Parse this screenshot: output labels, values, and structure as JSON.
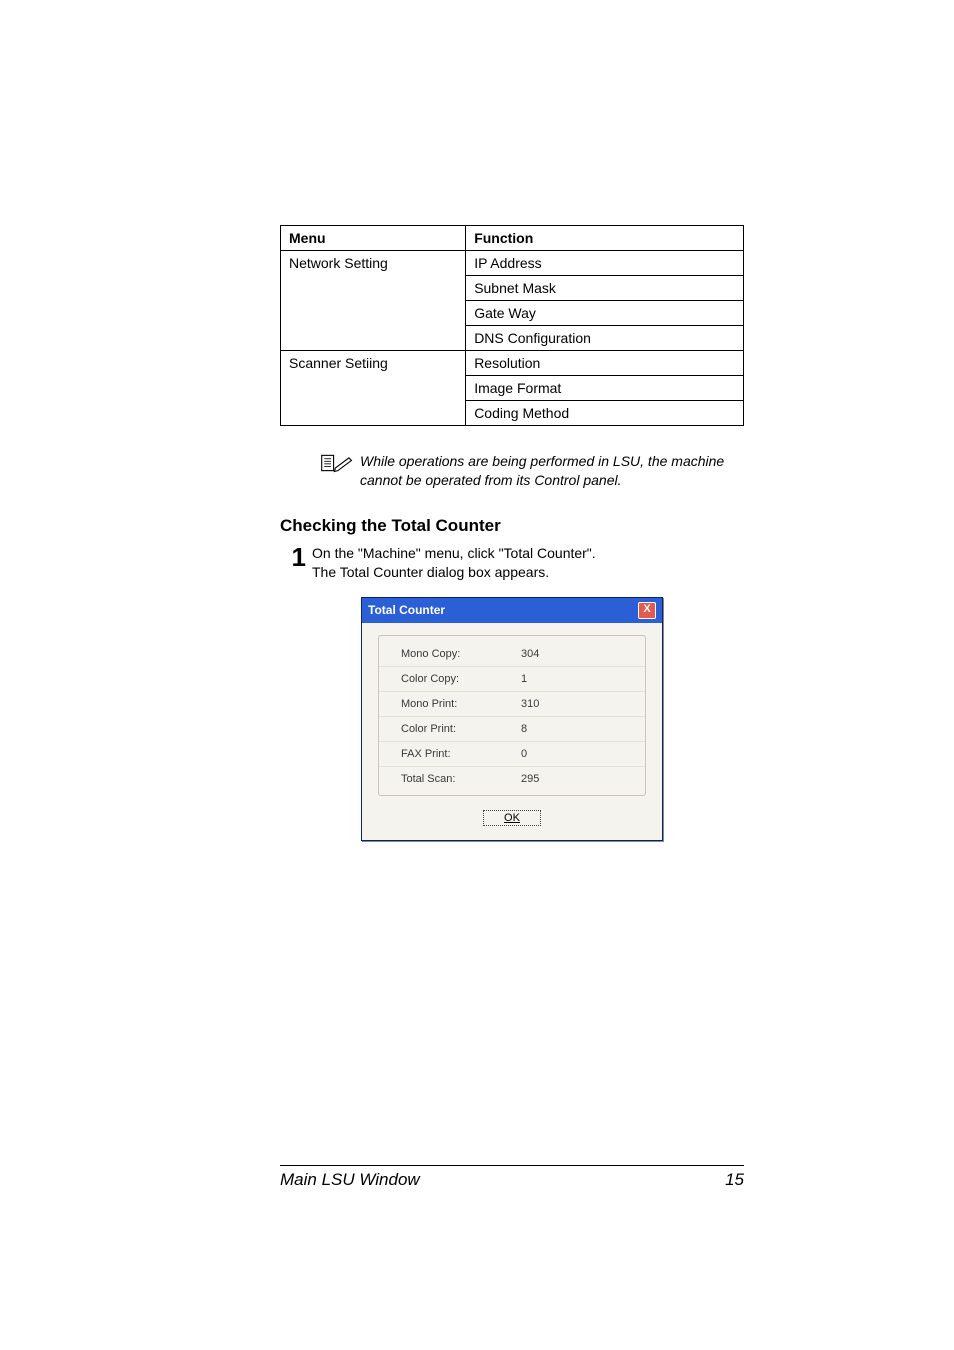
{
  "table": {
    "headers": {
      "menu": "Menu",
      "function": "Function"
    },
    "rows": [
      {
        "menu": "Network Setting",
        "functions": [
          "IP Address",
          "Subnet Mask",
          "Gate Way",
          "DNS Configuration"
        ]
      },
      {
        "menu": "Scanner Setiing",
        "functions": [
          "Resolution",
          "Image Format",
          "Coding Method"
        ]
      }
    ]
  },
  "note": {
    "text": "While operations are being performed in LSU, the machine cannot be operated from its Control panel."
  },
  "section": {
    "heading": "Checking the Total Counter",
    "step_number": "1",
    "step_line1": "On the \"Machine\" menu, click \"Total Counter\".",
    "step_line2": "The Total Counter dialog box appears."
  },
  "dialog": {
    "title": "Total Counter",
    "close_glyph": "X",
    "rows": [
      {
        "label": "Mono Copy:",
        "value": "304"
      },
      {
        "label": "Color Copy:",
        "value": "1"
      },
      {
        "label": "Mono Print:",
        "value": "310"
      },
      {
        "label": "Color Print:",
        "value": "8"
      },
      {
        "label": "FAX Print:",
        "value": "0"
      },
      {
        "label": "Total Scan:",
        "value": "295"
      }
    ],
    "ok_label": "OK"
  },
  "footer": {
    "title": "Main LSU Window",
    "page": "15"
  }
}
